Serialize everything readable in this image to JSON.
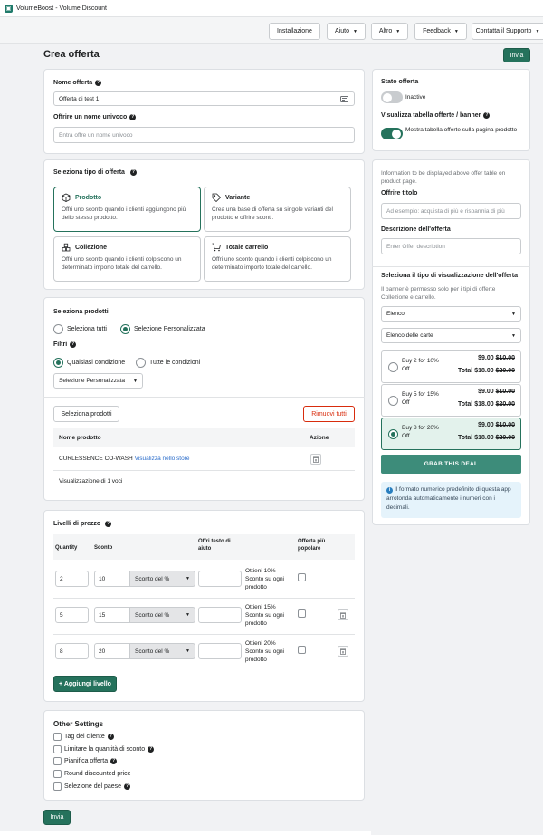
{
  "app": {
    "title": "VolumeBoost - Volume Discount"
  },
  "nav": {
    "installazione": "Installazione",
    "aiuto": "Aiuto",
    "altro": "Altro",
    "feedback": "Feedback",
    "contatta": "Contatta il Supporto"
  },
  "page": {
    "title": "Crea offerta",
    "submit_top": "Invia",
    "submit_bottom": "Invia"
  },
  "offer_name": {
    "label": "Nome offerta",
    "value": "Offerta di test 1",
    "unique_label": "Offrire un nome univoco",
    "unique_placeholder": "Entra offre un nome univoco"
  },
  "offer_type": {
    "label": "Seleziona tipo di offerta",
    "tiles": [
      {
        "title": "Prodotto",
        "desc": "Offri uno sconto quando i clienti aggiungono più dello stesso prodotto."
      },
      {
        "title": "Variante",
        "desc": "Crea una base di offerta su singole varianti del prodotto e offrire sconti."
      },
      {
        "title": "Collezione",
        "desc": "Offri uno sconto quando i clienti colpiscono un determinato importo totale del carrello."
      },
      {
        "title": "Totale carrello",
        "desc": "Offri uno sconto quando i clienti colpiscono un determinato importo totale del carrello."
      }
    ]
  },
  "products": {
    "label": "Seleziona prodotti",
    "opt_all": "Seleziona tutti",
    "opt_custom": "Selezione Personalizzata",
    "filters_label": "Filtri",
    "cond_any": "Qualsiasi condizione",
    "cond_all": "Tutte le condizioni",
    "filter_select": "Selezione Personalizzata",
    "select_btn": "Seleziona prodotti",
    "remove_btn": "Rimuovi tutti",
    "col_name": "Nome prodotto",
    "col_action": "Azione",
    "rows": [
      {
        "name": "CURLESSENCE CO-WASH",
        "link": "Visualizza nello store"
      }
    ],
    "count": "Visualizzazione di 1 voci"
  },
  "tiers": {
    "label": "Livelli di prezzo",
    "col_qty": "Quantity",
    "col_discount": "Sconto",
    "col_help": "Offri testo di aiuto",
    "col_popular": "Offerta più popolare",
    "rows": [
      {
        "qty": "2",
        "discount": "10",
        "type": "Sconto del %",
        "help": "Ottieni 10% Sconto su ogni prodotto"
      },
      {
        "qty": "5",
        "discount": "15",
        "type": "Sconto del %",
        "help": "Ottieni 15% Sconto su ogni prodotto"
      },
      {
        "qty": "8",
        "discount": "20",
        "type": "Sconto del %",
        "help": "Ottieni 20% Sconto su ogni prodotto"
      }
    ],
    "add_btn": "+ Aggiungi livello"
  },
  "other": {
    "title": "Other Settings",
    "items": [
      "Tag del cliente",
      "Limitare la quantità di sconto",
      "Pianifica offerta",
      "Round discounted price",
      "Selezione del paese"
    ]
  },
  "status": {
    "label": "Stato offerta",
    "state": "Inactive",
    "table_label": "Visualizza tabella offerte / banner",
    "table_toggle": "Mostra tabella offerte sulla pagina prodotto"
  },
  "display": {
    "intro": "Information to be displayed above offer table on product page.",
    "title_label": "Offrire titolo",
    "title_placeholder": "Ad esempio: acquista di più e risparmia di più",
    "desc_label": "Descrizione dell'offerta",
    "desc_placeholder": "Enter Offer description",
    "vis_label": "Seleziona il tipo di visualizzazione dell'offerta",
    "vis_note": "Il banner è permesso solo per i tipi di offerte Collezione e carrello.",
    "sel1": "Elenco",
    "sel2": "Elenco delle carte"
  },
  "preview": {
    "tiers": [
      {
        "label": "Buy 2 for 10% Off",
        "price": "$9.00",
        "old": "$10.00",
        "total_label": "Total",
        "total": "$18.00",
        "total_old": "$20.00"
      },
      {
        "label": "Buy 5 for 15% Off",
        "price": "$9.00",
        "old": "$10.00",
        "total_label": "Total",
        "total": "$18.00",
        "total_old": "$20.00"
      },
      {
        "label": "Buy 8 for 20% Off",
        "price": "$9.00",
        "old": "$10.00",
        "total_label": "Total",
        "total": "$18.00",
        "total_old": "$20.00"
      }
    ],
    "grab": "GRAB THIS DEAL",
    "info": "Il formato numerico predefinito di questa app arrotonda automaticamente i numeri con i decimali."
  },
  "colors": {
    "primary": "#25725c",
    "danger": "#d82c0d",
    "info_bg": "#e5f3fb",
    "selected_tier": "#e3f2ec"
  }
}
